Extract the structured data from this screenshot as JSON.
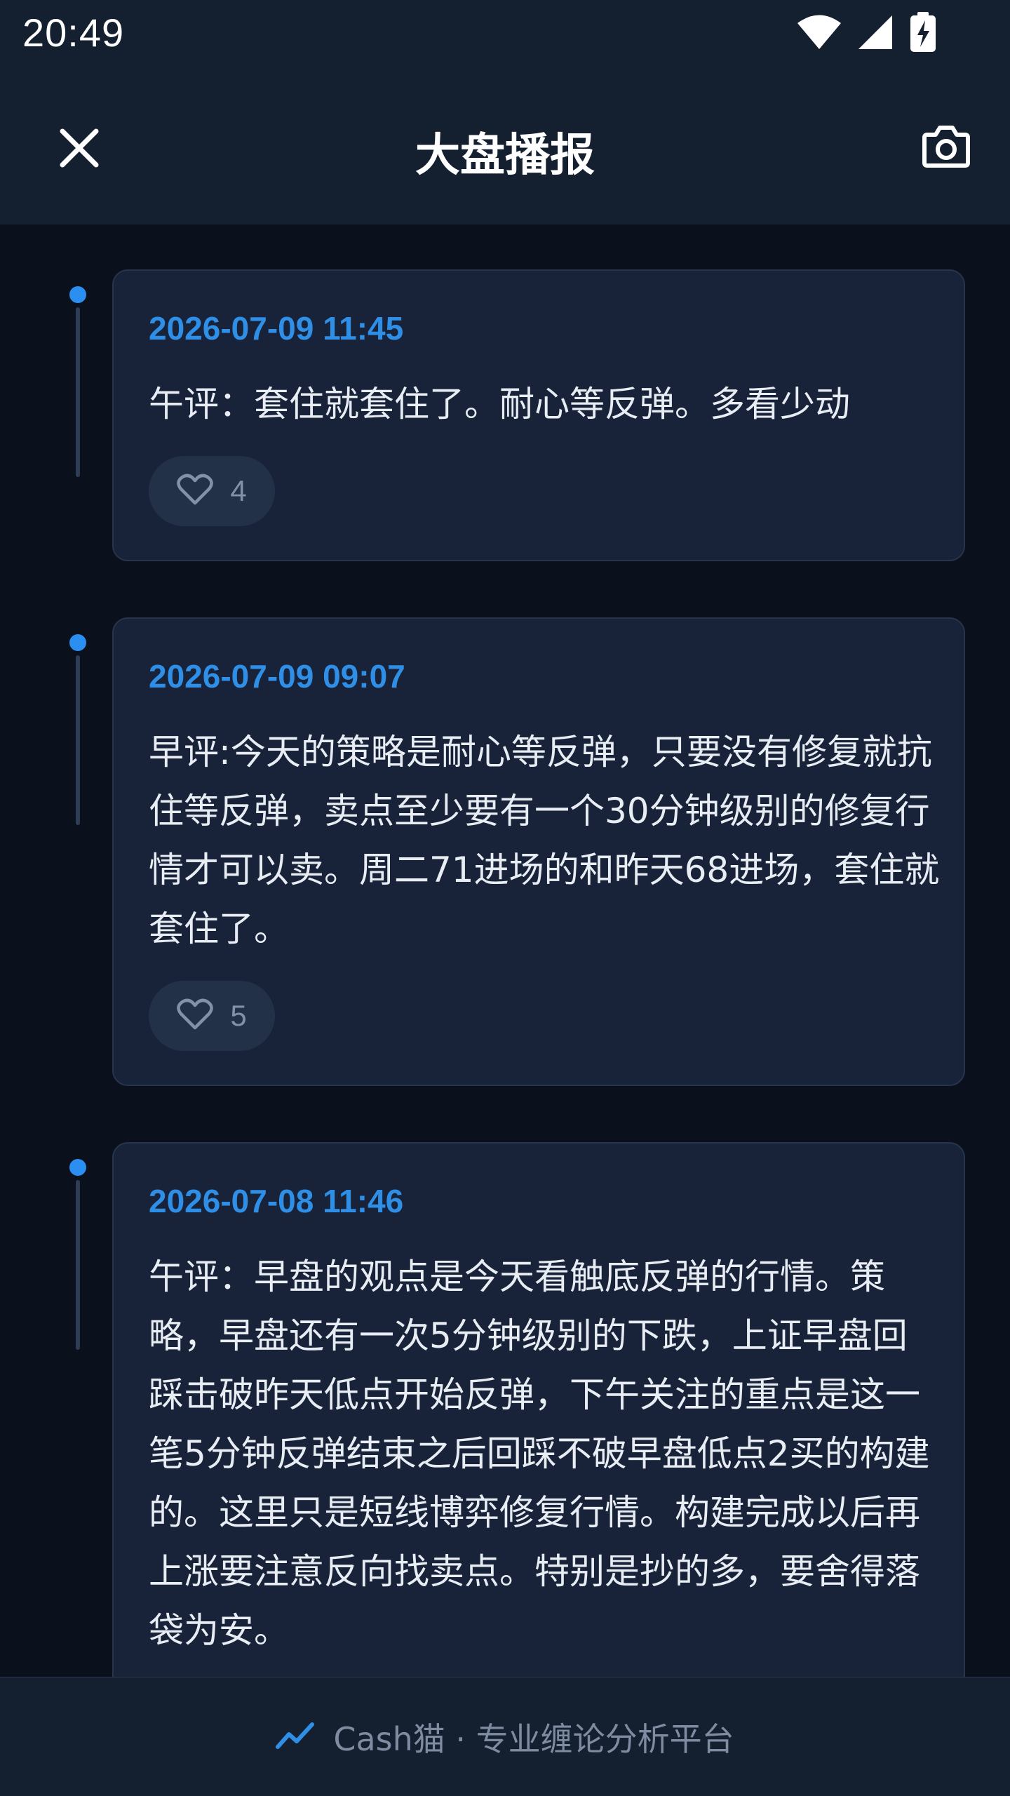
{
  "status_bar": {
    "time": "20:49",
    "icons": [
      "wifi-icon",
      "signal-icon",
      "battery-charging-icon"
    ]
  },
  "header": {
    "title": "大盘播报",
    "close_icon": "close-icon",
    "camera_icon": "camera-icon"
  },
  "feed": {
    "entries": [
      {
        "date": "2026-07-09 11:45",
        "text": "午评：套住就套住了。耐心等反弹。多看少动",
        "likes": "4"
      },
      {
        "date": "2026-07-09 09:07",
        "text": "早评:今天的策略是耐心等反弹，只要没有修复就抗住等反弹，卖点至少要有一个30分钟级别的修复行情才可以卖。周二71进场的和昨天68进场，套住就套住了。",
        "likes": "5"
      },
      {
        "date": "2026-07-08 11:46",
        "text": "午评：早盘的观点是今天看触底反弹的行情。策略，早盘还有一次5分钟级别的下跌，上证早盘回踩击破昨天低点开始反弹，下午关注的重点是这一笔5分钟反弹结束之后回踩不破早盘低点2买的构建的。这里只是短线博弈修复行情。构建完成以后再上涨要注意反向找卖点。特别是抄的多，要舍得落袋为安。"
      }
    ]
  },
  "footer": {
    "icon": "trend-line-icon",
    "text": "Cash猫 · 专业缠论分析平台"
  },
  "colors": {
    "background": "#0a111d",
    "header": "#141f30",
    "card": "#18233a",
    "accent": "#2f8fe6",
    "muted": "#7e8ba0"
  }
}
